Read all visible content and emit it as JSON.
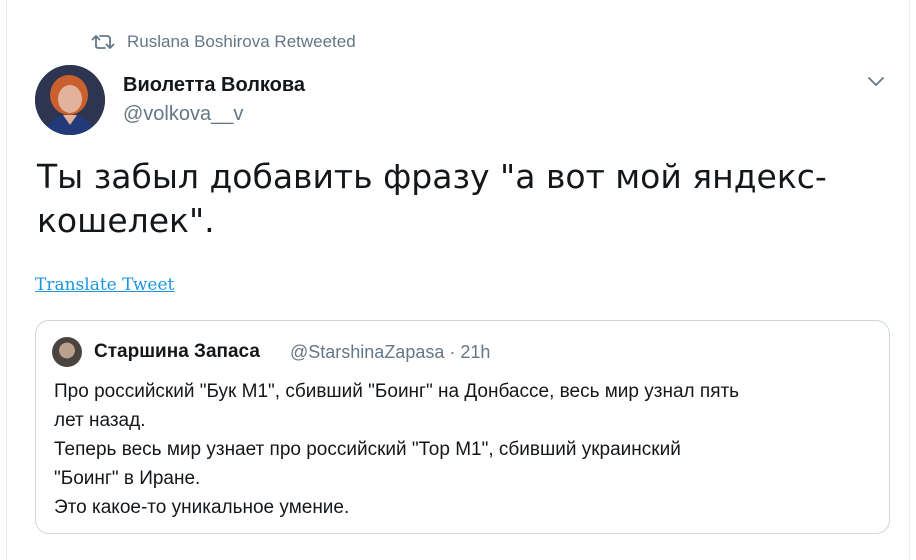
{
  "retweet": {
    "icon": "retweet-icon",
    "label": "Ruslana Boshirova Retweeted"
  },
  "author": {
    "name": "Виолетта Волкова",
    "handle": "@volkova__v",
    "avatar_icon": "avatar"
  },
  "menu": {
    "icon": "chevron-down-icon"
  },
  "tweet": {
    "text_line1": "Ты забыл добавить фразу \"а вот мой яндекс-",
    "text_line2": "кошелек\".",
    "translate_label": "Translate Tweet"
  },
  "quoted_tweet": {
    "author_name": "Старшина Запаса",
    "meta": "@StarshinaZapasa · 21h",
    "lines": [
      "Про российский \"Бук М1\", сбивший \"Боинг\" на Донбассе, весь мир узнал пять",
      "лет назад.",
      "Теперь весь мир узнает про российский \"Тор М1\", сбивший украинский",
      "\"Боинг\" в Иране.",
      "Это какое-то уникальное умение."
    ]
  },
  "colors": {
    "secondary_text": "#657786",
    "link": "#1b95e0",
    "border": "#ccd6dd"
  }
}
